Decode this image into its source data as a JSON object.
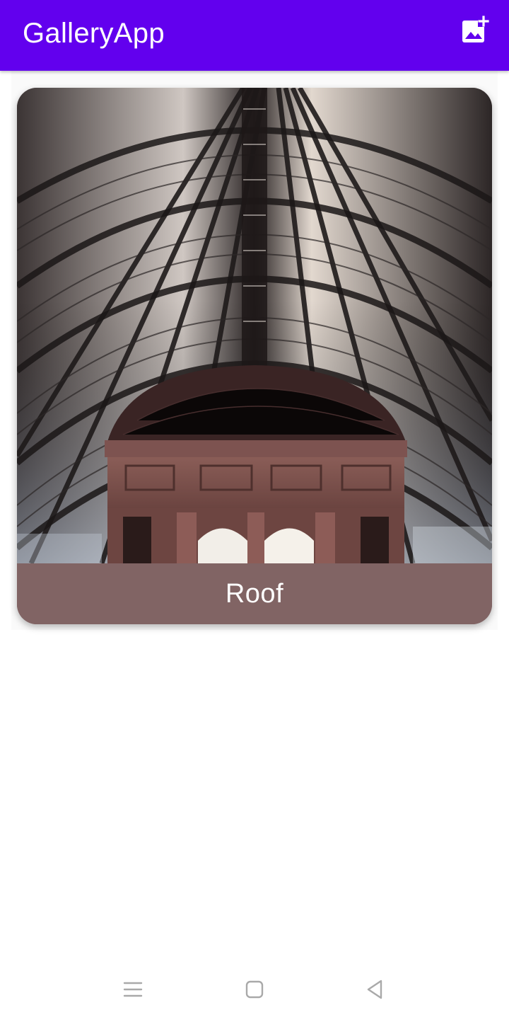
{
  "app_bar": {
    "title": "GalleryApp",
    "color": "#6200ee",
    "action_icon": "add-photo-icon"
  },
  "gallery": {
    "items": [
      {
        "caption": "Roof",
        "image_description_icon": "roof-photo",
        "caption_bg": "#816464"
      }
    ]
  },
  "system_nav": {
    "icons": [
      "menu-icon",
      "home-icon",
      "back-icon"
    ]
  }
}
